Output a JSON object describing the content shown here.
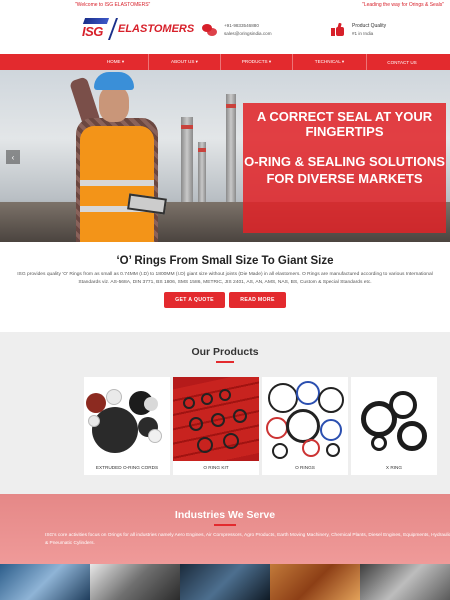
{
  "topbar": {
    "welcome": "\"Welcome to ISG ELASTOMERS\"",
    "tagline": "\"Leading the way for Orings & Seals\""
  },
  "header": {
    "logo_mark": "ISG",
    "logo_text": "ELASTOMERS",
    "phone": "+91-9833546880",
    "email": "sales@oringsindia.com",
    "quality_title": "Product Quality",
    "quality_sub": "#1 in India"
  },
  "nav": {
    "items": [
      {
        "label": "HOME ▾"
      },
      {
        "label": "ABOUT US ▾"
      },
      {
        "label": "PRODUCTS ▾"
      },
      {
        "label": "TECHNICAL ▾"
      },
      {
        "label": "CONTACT US"
      }
    ]
  },
  "hero": {
    "line1": "A CORRECT SEAL AT YOUR FINGERTIPS",
    "line2": "O-RING & SEALING SOLUTIONS FOR DIVERSE MARKETS",
    "prev_arrow": "‹"
  },
  "intro": {
    "title": "‘O’ Rings From Small Size To Giant Size",
    "body": "ISG provides quality 'O' Rings from as small as 0.74MM (I.D) to 1800MM (I.D) giant size without joints (Die Made) in all elastomers. O Rings are manufactured according to various International Standards viz. AS-568A, DIN 3771, BS 1806, SMS 1586, METRIC, JIS 2401, AS, AN, AMS, NAS, BS, Custom & Special Standards etc.",
    "quote_button": "GET A QUOTE",
    "read_button": "READ MORE"
  },
  "products": {
    "title": "Our Products",
    "items": [
      {
        "label": "EXTRUDED O-RING CORDS",
        "icon": "o-ring-cords-image"
      },
      {
        "label": "O RING KIT",
        "icon": "o-ring-kit-image"
      },
      {
        "label": "O RINGS",
        "icon": "o-rings-image"
      },
      {
        "label": "X RING",
        "icon": "x-ring-image"
      }
    ]
  },
  "industries": {
    "title": "Industries We Serve",
    "body": "ISG's core activities focus on Orings for all industries namely Aero Engines, Air Compressors, Agro Products, Earth Moving Machinery, Chemical Plants, Diesel Engines, Equipments, Hydraulic & Pneumatic Cylinders."
  },
  "colors": {
    "brand_red": "#e32a2e",
    "brand_blue": "#1a2f8a"
  }
}
